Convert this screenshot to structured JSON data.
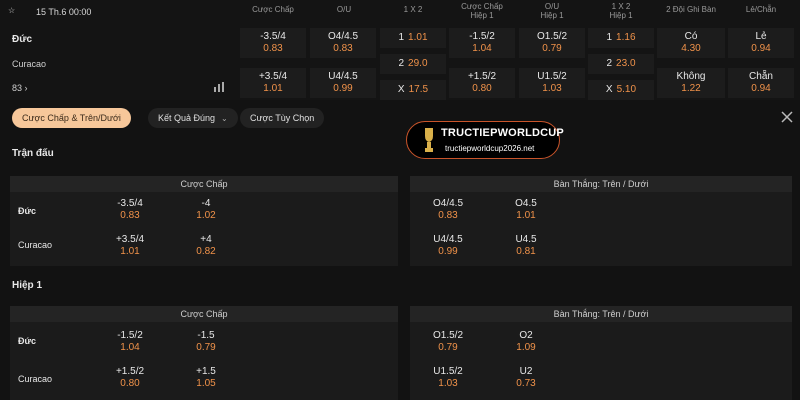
{
  "match": {
    "datetime": "15 Th.6 00:00",
    "team1": "Đức",
    "team2": "Curacao",
    "more_count": "83",
    "more_arrow": "›"
  },
  "columns": [
    "Cược Chấp",
    "O/U",
    "1 X 2",
    "Cược Chấp\nHiệp 1",
    "O/U\nHiệp 1",
    "1 X 2\nHiệp 1",
    "2 Đội Ghi Bàn",
    "Lẻ/Chẵn"
  ],
  "odds_row1": [
    {
      "label": "-3.5/4",
      "odd": "0.83"
    },
    {
      "label": "O4/4.5",
      "odd": "0.83"
    },
    {
      "label": "1",
      "odd": "1.01"
    },
    {
      "label": "-1.5/2",
      "odd": "1.04"
    },
    {
      "label": "O1.5/2",
      "odd": "0.79"
    },
    {
      "label": "1",
      "odd": "1.16"
    },
    {
      "label": "Có",
      "odd": "4.30"
    },
    {
      "label": "Lẻ",
      "odd": "0.94"
    }
  ],
  "odds_mid": [
    {
      "label": "2",
      "odd": "29.0"
    },
    {
      "label": "2",
      "odd": "23.0"
    }
  ],
  "odds_row2": [
    {
      "label": "+3.5/4",
      "odd": "1.01"
    },
    {
      "label": "U4/4.5",
      "odd": "0.99"
    },
    {
      "label": "X",
      "odd": "17.5"
    },
    {
      "label": "+1.5/2",
      "odd": "0.80"
    },
    {
      "label": "U1.5/2",
      "odd": "1.03"
    },
    {
      "label": "X",
      "odd": "5.10"
    },
    {
      "label": "Không",
      "odd": "1.22"
    },
    {
      "label": "Chẵn",
      "odd": "0.94"
    }
  ],
  "filters": {
    "handicap_ou": "Cược Chấp & Trên/Dưới",
    "correct_score": "Kết Quả Đúng",
    "custom": "Cược Tùy Chọn"
  },
  "watermark": {
    "brand": "TRUCTIEPWORLDCUP",
    "url": "tructiepworldcup2026.net"
  },
  "sections": [
    {
      "title": "Trận đấu",
      "left": {
        "header": "Cược Chấp",
        "rows": [
          {
            "team": "Đức",
            "a_label": "-3.5/4",
            "a_odd": "0.83",
            "b_label": "-4",
            "b_odd": "1.02"
          },
          {
            "team": "Curacao",
            "a_label": "+3.5/4",
            "a_odd": "1.01",
            "b_label": "+4",
            "b_odd": "0.82"
          }
        ]
      },
      "right": {
        "header": "Bàn Thắng: Trên / Dưới",
        "rows": [
          {
            "a_label": "O4/4.5",
            "a_odd": "0.83",
            "b_label": "O4.5",
            "b_odd": "1.01"
          },
          {
            "a_label": "U4/4.5",
            "a_odd": "0.99",
            "b_label": "U4.5",
            "b_odd": "0.81"
          }
        ]
      }
    },
    {
      "title": "Hiệp 1",
      "left": {
        "header": "Cược Chấp",
        "rows": [
          {
            "team": "Đức",
            "a_label": "-1.5/2",
            "a_odd": "1.04",
            "b_label": "-1.5",
            "b_odd": "0.79"
          },
          {
            "team": "Curacao",
            "a_label": "+1.5/2",
            "a_odd": "0.80",
            "b_label": "+1.5",
            "b_odd": "1.05"
          }
        ]
      },
      "right": {
        "header": "Bàn Thắng: Trên / Dưới",
        "rows": [
          {
            "a_label": "O1.5/2",
            "a_odd": "0.79",
            "b_label": "O2",
            "b_odd": "1.09"
          },
          {
            "a_label": "U1.5/2",
            "a_odd": "1.03",
            "b_label": "U2",
            "b_odd": "0.73"
          }
        ]
      }
    }
  ],
  "colors": {
    "background": "#121212",
    "odd": "#f0924a",
    "active_chip": "#f6c79a"
  }
}
